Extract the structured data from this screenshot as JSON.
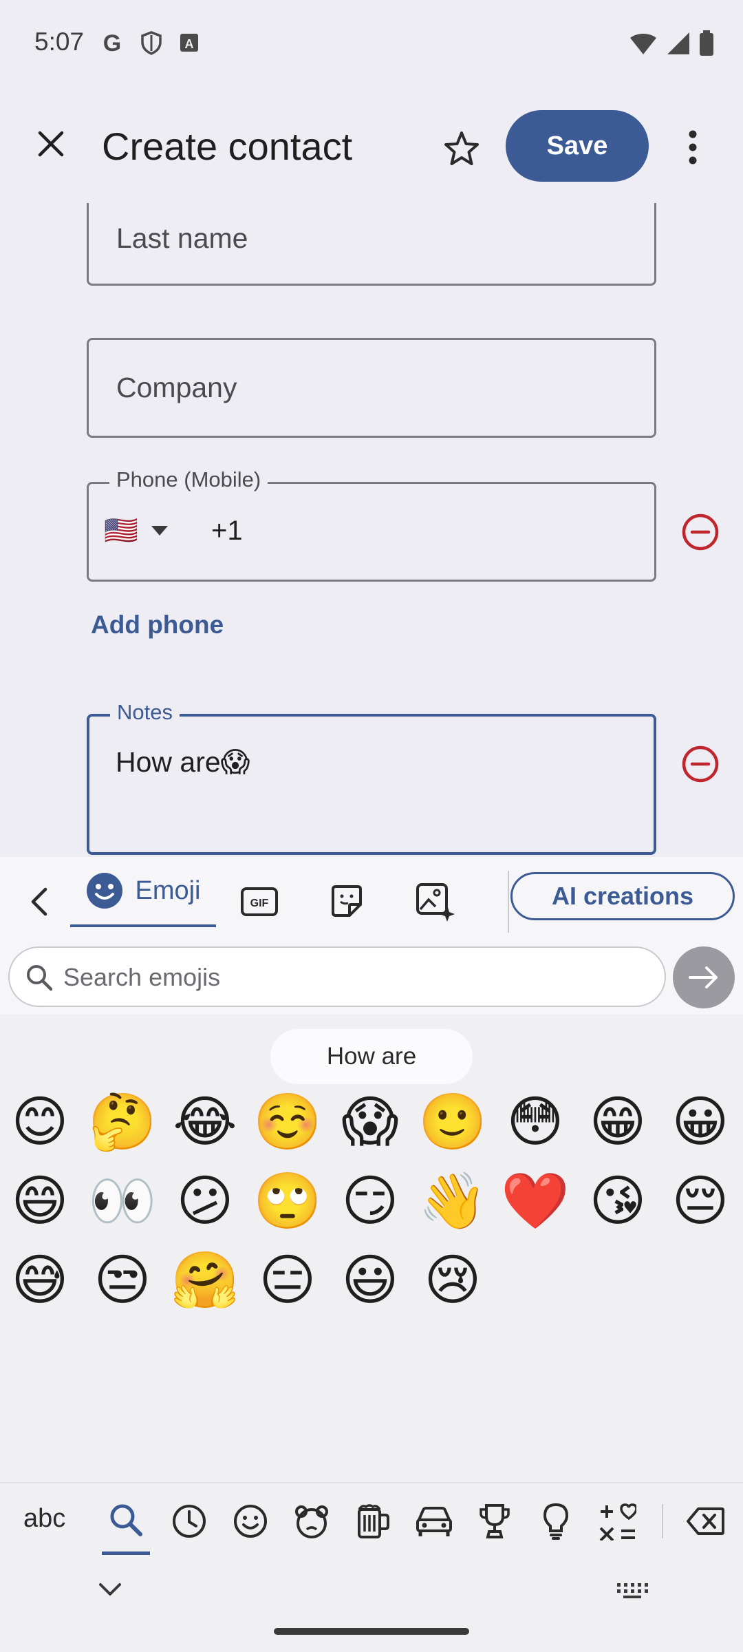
{
  "status_bar": {
    "time": "5:07"
  },
  "app_bar": {
    "title": "Create contact",
    "save_label": "Save"
  },
  "form": {
    "last_name_placeholder": "Last name",
    "company_placeholder": "Company",
    "phone_label": "Phone (Mobile)",
    "phone_country_flag": "🇺🇸",
    "phone_value": "+1",
    "add_phone_label": "Add phone",
    "notes_label": "Notes",
    "notes_value": "How are😱"
  },
  "emoji_panel": {
    "emoji_tab_label": "Emoji",
    "ai_creations_label": "AI creations",
    "search_placeholder": "Search emojis",
    "suggestion_text": "How are",
    "emojis": [
      "😊",
      "🤔",
      "😂",
      "☺️",
      "😱",
      "🙂",
      "😳",
      "😁",
      "😀",
      "😄",
      "👀",
      "😕",
      "🙄",
      "😏",
      "👋",
      "❤️",
      "😘",
      "😔",
      "😅",
      "😒",
      "🤗",
      "😑",
      "😃",
      "😢"
    ]
  },
  "category_bar": {
    "abc_label": "abc"
  },
  "colors": {
    "accent": "#3c5a94",
    "remove": "#c0262d"
  }
}
